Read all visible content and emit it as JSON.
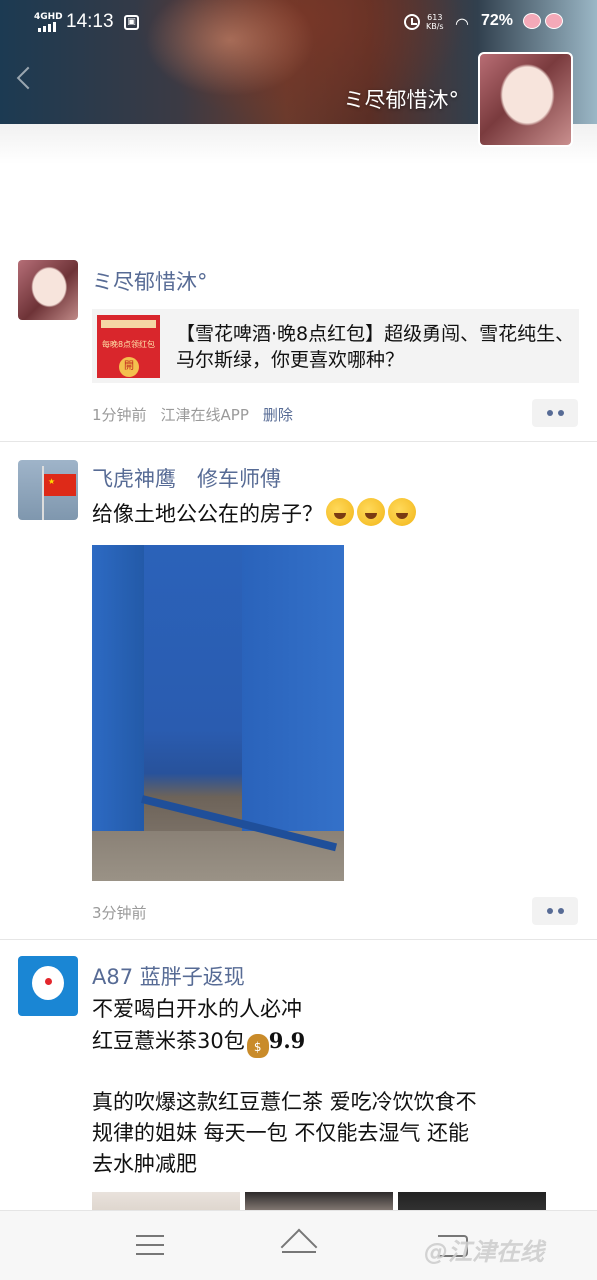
{
  "status_bar": {
    "network": "4GHD",
    "time": "14:13",
    "speed_value": "613",
    "speed_unit": "KB/s",
    "battery": "72%"
  },
  "profile": {
    "name": "ミ尽郁惜沐°"
  },
  "posts": [
    {
      "nickname": "ミ尽郁惜沐°",
      "share": {
        "thumb_text": "每晚8点领红包",
        "thumb_button": "開",
        "title": "【雪花啤酒·晚8点红包】超级勇闯、雪花纯生、马尔斯绿，你更喜欢哪种？"
      },
      "time": "1分钟前",
      "source": "江津在线APP",
      "delete_label": "删除"
    },
    {
      "nickname": "飞虎神鹰　修车师傅",
      "text": "给像土地公公在的房子？",
      "time": "3分钟前"
    },
    {
      "nickname": "A87 蓝胖子返现",
      "line1": "不爱喝白开水的人必冲",
      "line2": "红豆薏米茶30包",
      "money_glyph": "$",
      "price": "9.9",
      "body_line1": "真的吹爆这款红豆薏仁茶 爱吃冷饮饮食不",
      "body_line2": "规律的姐妹 每天一包 不仅能去湿气 还能",
      "body_line3": "去水肿减肥"
    }
  ],
  "watermark": "@江津在线",
  "icons": {
    "more": "more-dots-icon",
    "back": "back-chevron-icon",
    "nav_menu": "menu-icon",
    "nav_home": "home-icon",
    "nav_back": "back-icon"
  },
  "colors": {
    "link": "#576b95",
    "meta": "#9a9a9a",
    "card_bg": "#f3f3f3"
  }
}
